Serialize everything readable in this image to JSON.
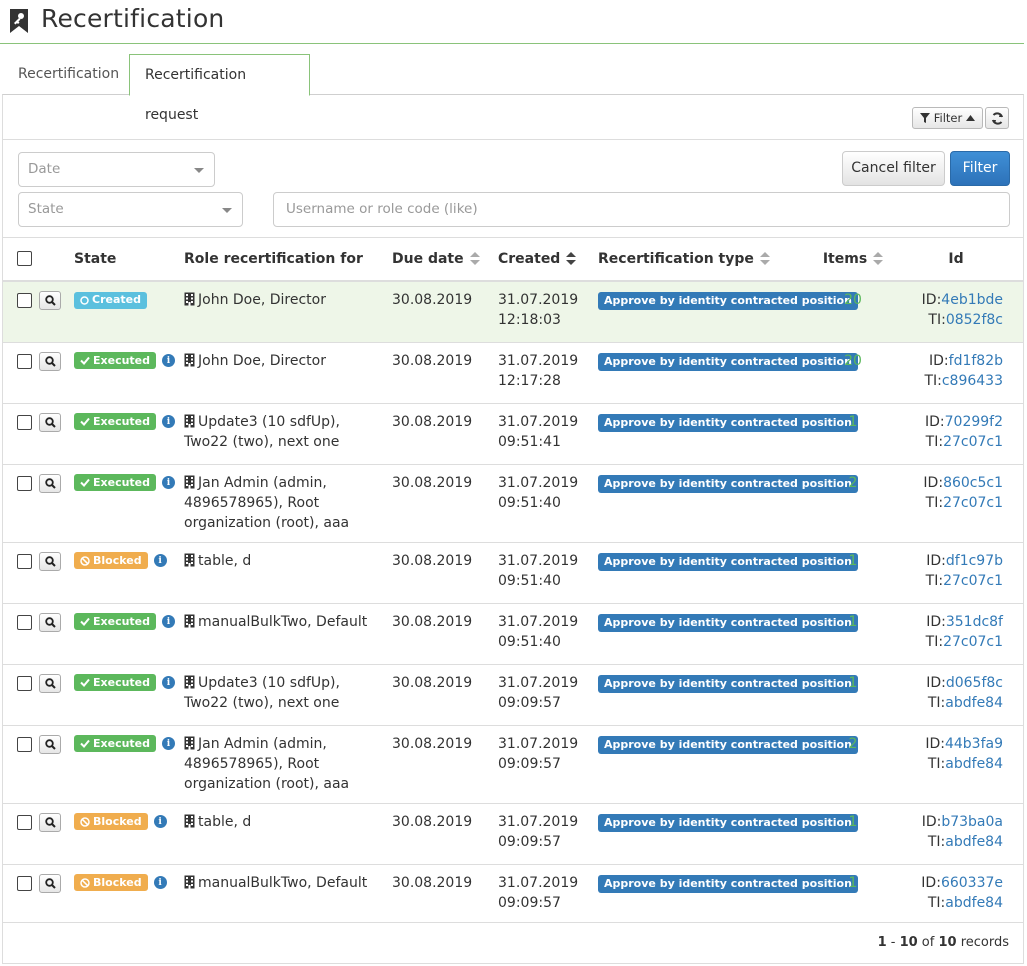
{
  "page": {
    "title": "Recertification"
  },
  "tabs": [
    {
      "label": "Recertification",
      "active": false
    },
    {
      "label": "Recertification request",
      "active": true
    }
  ],
  "toolbar": {
    "filter_label": "Filter"
  },
  "filters": {
    "date_placeholder": "Date",
    "state_placeholder": "State",
    "search_placeholder": "Username or role code (like)",
    "cancel_label": "Cancel filter",
    "apply_label": "Filter"
  },
  "table": {
    "headers": {
      "state": "State",
      "role": "Role recertification for",
      "due": "Due date",
      "created": "Created",
      "type": "Recertification type",
      "items": "Items",
      "id": "Id"
    },
    "rows": [
      {
        "state": "Created",
        "role": "John Doe, Director",
        "due": "30.08.2019",
        "created_date": "31.07.2019",
        "created_time": "12:18:03",
        "type": "Approve by identity contracted position",
        "items": "20",
        "id_label": "ID:",
        "id": "4eb1bde",
        "ti_label": "TI:",
        "ti": "0852f8c"
      },
      {
        "state": "Executed",
        "role": "John Doe, Director",
        "due": "30.08.2019",
        "created_date": "31.07.2019",
        "created_time": "12:17:28",
        "type": "Approve by identity contracted position",
        "items": "20",
        "id_label": "ID:",
        "id": "fd1f82b",
        "ti_label": "TI:",
        "ti": "c896433"
      },
      {
        "state": "Executed",
        "role": "Update3 (10 sdfUp), Two22 (two), next one",
        "due": "30.08.2019",
        "created_date": "31.07.2019",
        "created_time": "09:51:41",
        "type": "Approve by identity contracted position",
        "items": "1",
        "id_label": "ID:",
        "id": "70299f2",
        "ti_label": "TI:",
        "ti": "27c07c1"
      },
      {
        "state": "Executed",
        "role": "Jan Admin (admin, 4896578965), Root organization (root), aaa",
        "due": "30.08.2019",
        "created_date": "31.07.2019",
        "created_time": "09:51:40",
        "type": "Approve by identity contracted position",
        "items": "2",
        "id_label": "ID:",
        "id": "860c5c1",
        "ti_label": "TI:",
        "ti": "27c07c1"
      },
      {
        "state": "Blocked",
        "role": "table, d",
        "due": "30.08.2019",
        "created_date": "31.07.2019",
        "created_time": "09:51:40",
        "type": "Approve by identity contracted position",
        "items": "1",
        "id_label": "ID:",
        "id": "df1c97b",
        "ti_label": "TI:",
        "ti": "27c07c1"
      },
      {
        "state": "Executed",
        "role": "manualBulkTwo, Default",
        "due": "30.08.2019",
        "created_date": "31.07.2019",
        "created_time": "09:51:40",
        "type": "Approve by identity contracted position",
        "items": "1",
        "id_label": "ID:",
        "id": "351dc8f",
        "ti_label": "TI:",
        "ti": "27c07c1"
      },
      {
        "state": "Executed",
        "role": "Update3 (10 sdfUp), Two22 (two), next one",
        "due": "30.08.2019",
        "created_date": "31.07.2019",
        "created_time": "09:09:57",
        "type": "Approve by identity contracted position",
        "items": "1",
        "id_label": "ID:",
        "id": "d065f8c",
        "ti_label": "TI:",
        "ti": "abdfe84"
      },
      {
        "state": "Executed",
        "role": "Jan Admin (admin, 4896578965), Root organization (root), aaa",
        "due": "30.08.2019",
        "created_date": "31.07.2019",
        "created_time": "09:09:57",
        "type": "Approve by identity contracted position",
        "items": "2",
        "id_label": "ID:",
        "id": "44b3fa9",
        "ti_label": "TI:",
        "ti": "abdfe84"
      },
      {
        "state": "Blocked",
        "role": "table, d",
        "due": "30.08.2019",
        "created_date": "31.07.2019",
        "created_time": "09:09:57",
        "type": "Approve by identity contracted position",
        "items": "1",
        "id_label": "ID:",
        "id": "b73ba0a",
        "ti_label": "TI:",
        "ti": "abdfe84"
      },
      {
        "state": "Blocked",
        "role": "manualBulkTwo, Default",
        "due": "30.08.2019",
        "created_date": "31.07.2019",
        "created_time": "09:09:57",
        "type": "Approve by identity contracted position",
        "items": "1",
        "id_label": "ID:",
        "id": "660337e",
        "ti_label": "TI:",
        "ti": "abdfe84"
      }
    ]
  },
  "pagination": {
    "from": "1",
    "dash": " - ",
    "to": "10",
    "of": " of ",
    "total": "10",
    "suffix": " records"
  },
  "icons": {
    "header": "recertification-key-icon",
    "filter": "funnel-icon",
    "refresh": "refresh-icon",
    "detail": "magnifier-icon",
    "info": "info-icon",
    "role": "building-icon"
  },
  "colors": {
    "accent": "#8ac37a",
    "primary": "#337ab7",
    "created": "#5bc0de",
    "executed": "#5cb85c",
    "blocked": "#f0ad4e",
    "selected_row": "#eef6e8"
  }
}
